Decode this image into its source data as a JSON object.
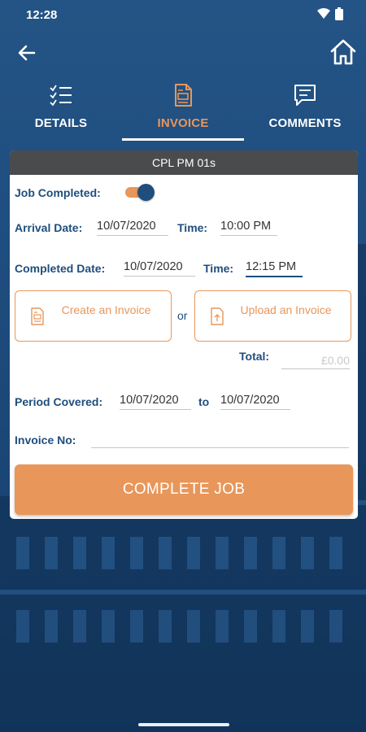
{
  "status_bar": {
    "time": "12:28"
  },
  "tabs": [
    {
      "label": "DETAILS",
      "icon": "checklist-icon"
    },
    {
      "label": "INVOICE",
      "icon": "invoice-document-icon"
    },
    {
      "label": "COMMENTS",
      "icon": "comment-icon"
    }
  ],
  "active_tab": "INVOICE",
  "card": {
    "title": "CPL PM 01s",
    "job_completed": {
      "label": "Job Completed:",
      "value": true
    },
    "arrival": {
      "date_label": "Arrival Date:",
      "date": "10/07/2020",
      "time_label": "Time:",
      "time": "10:00 PM"
    },
    "completed": {
      "date_label": "Completed Date:",
      "date": "10/07/2020",
      "time_label": "Time:",
      "time": "12:15 PM"
    },
    "create_invoice": {
      "label": "Create an Invoice"
    },
    "or_label": "or",
    "upload_invoice": {
      "label": "Upload an Invoice"
    },
    "total": {
      "label": "Total:",
      "value": "£0.00"
    },
    "period": {
      "label": "Period Covered:",
      "from": "10/07/2020",
      "to_label": "to",
      "to": "10/07/2020"
    },
    "invoice_no": {
      "label": "Invoice No:",
      "value": ""
    },
    "complete_button": "COMPLETE JOB"
  },
  "colors": {
    "primary": "#1f4e7d",
    "accent": "#e8965a",
    "header": "#4a4b4d"
  }
}
